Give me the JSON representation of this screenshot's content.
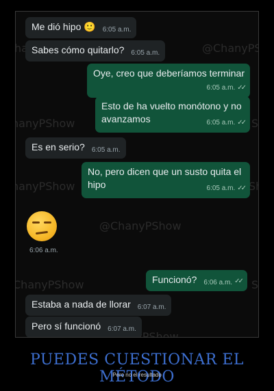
{
  "watermark": "@ChanyPShow",
  "watermark_partials": {
    "w1": "ha",
    "w2": "@ChanyPSh",
    "w3": "hanyPShow",
    "w4": "S",
    "w5": "hanyPShow",
    "w6": "Sh",
    "w7": "@ChanyPShow",
    "w8": "ChanyPShow",
    "w9": "S",
    "w10": "@ChanyPShow"
  },
  "messages": [
    {
      "dir": "in",
      "text": "Me dió hipo 🙂",
      "time": "6:05 a.m."
    },
    {
      "dir": "in",
      "text": "Sabes cómo quitarlo?",
      "time": "6:05 a.m."
    },
    {
      "dir": "out",
      "text": "Oye, creo que deberíamos terminar",
      "time": "6:05 a.m."
    },
    {
      "dir": "out",
      "text": "Esto de ha vuelto monótono y no avanzamos",
      "time": "6:05 a.m."
    },
    {
      "dir": "in",
      "text": "Es en serio?",
      "time": "6:05 a.m."
    },
    {
      "dir": "out",
      "text": "No, pero dicen que un susto quita el hipo",
      "time": "6:05 a.m."
    },
    {
      "dir": "in",
      "text": "",
      "time": "6:06 a.m.",
      "emoji": "unamused-face"
    },
    {
      "dir": "out",
      "text": "Funcionó?",
      "time": "6:06 a.m."
    },
    {
      "dir": "in",
      "text": "Estaba a nada de llorar",
      "time": "6:07 a.m."
    },
    {
      "dir": "in",
      "text": "Pero sí funcionó",
      "time": "6:07 a.m."
    }
  ],
  "read_ticks": "✓✓",
  "caption": {
    "title": "PUEDES CUESTIONAR EL MÉTODO",
    "subtitle": "Pero no el resultado"
  },
  "colors": {
    "incoming_bubble": "#1f2325",
    "outgoing_bubble": "#11543a",
    "caption_title": "#3d6fd0"
  }
}
